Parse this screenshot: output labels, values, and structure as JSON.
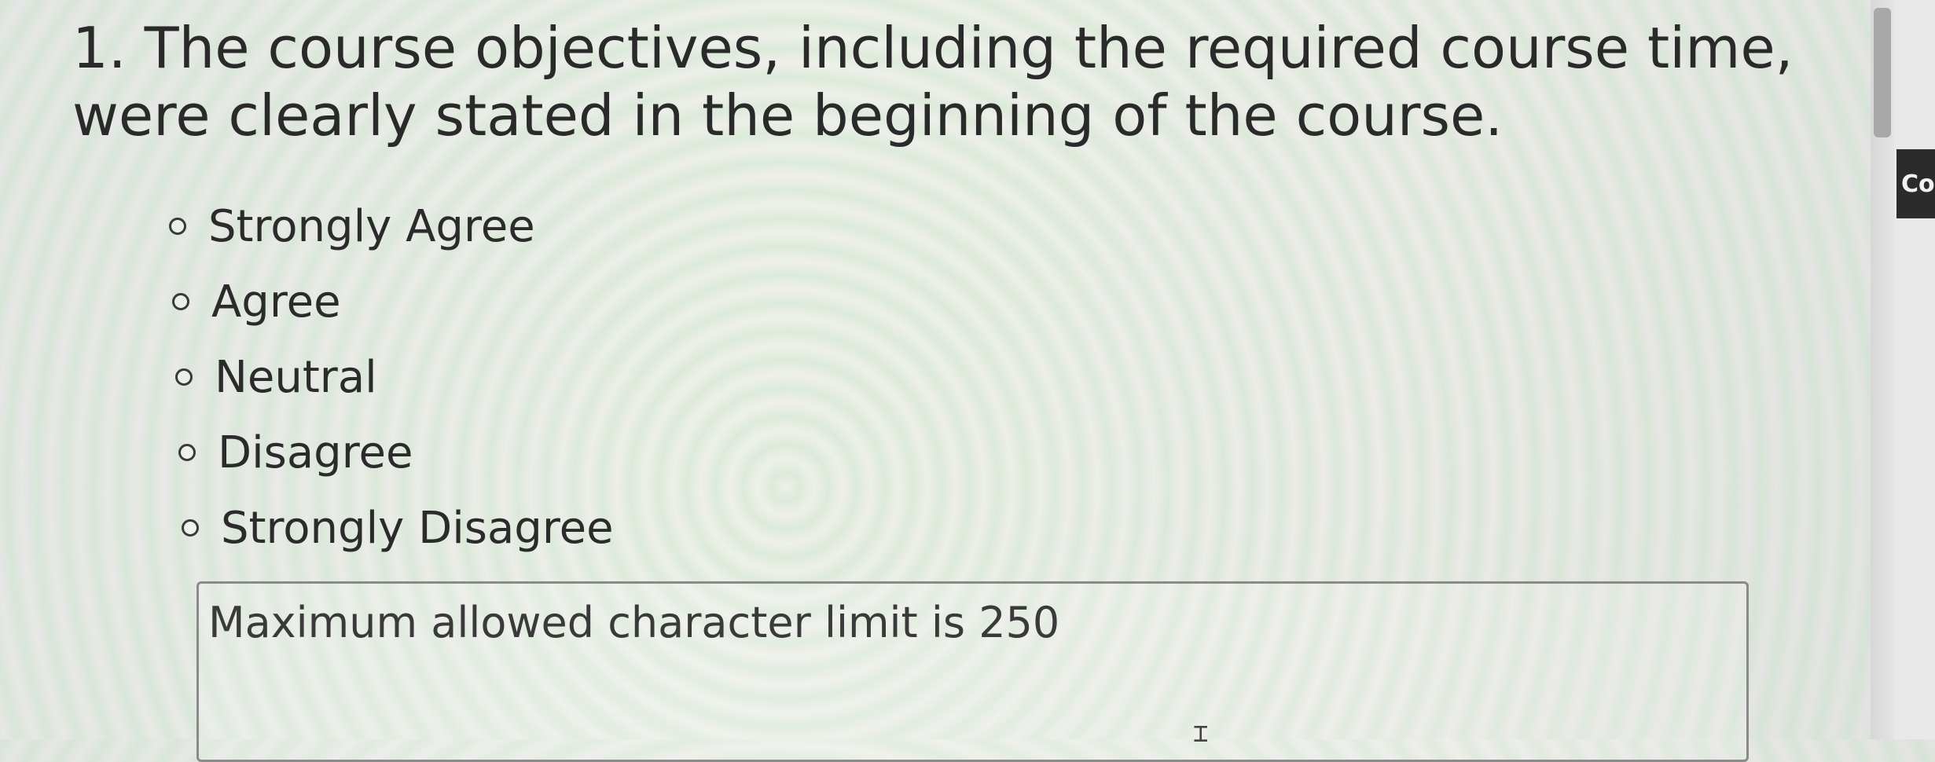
{
  "question": {
    "number": "1.",
    "text": "The course objectives, including the required course time, were clearly stated in the beginning of the course."
  },
  "options": [
    {
      "label": "Strongly Agree",
      "selected": false
    },
    {
      "label": "Agree",
      "selected": false
    },
    {
      "label": "Neutral",
      "selected": false
    },
    {
      "label": "Disagree",
      "selected": false
    },
    {
      "label": "Strongly Disagree",
      "selected": false
    }
  ],
  "comment": {
    "placeholder": "Maximum allowed character limit is 250",
    "value": ""
  },
  "side_button": {
    "label": "Co"
  },
  "icons": {
    "radio": "radio-unselected-icon",
    "text_cursor": "text-cursor-icon"
  }
}
